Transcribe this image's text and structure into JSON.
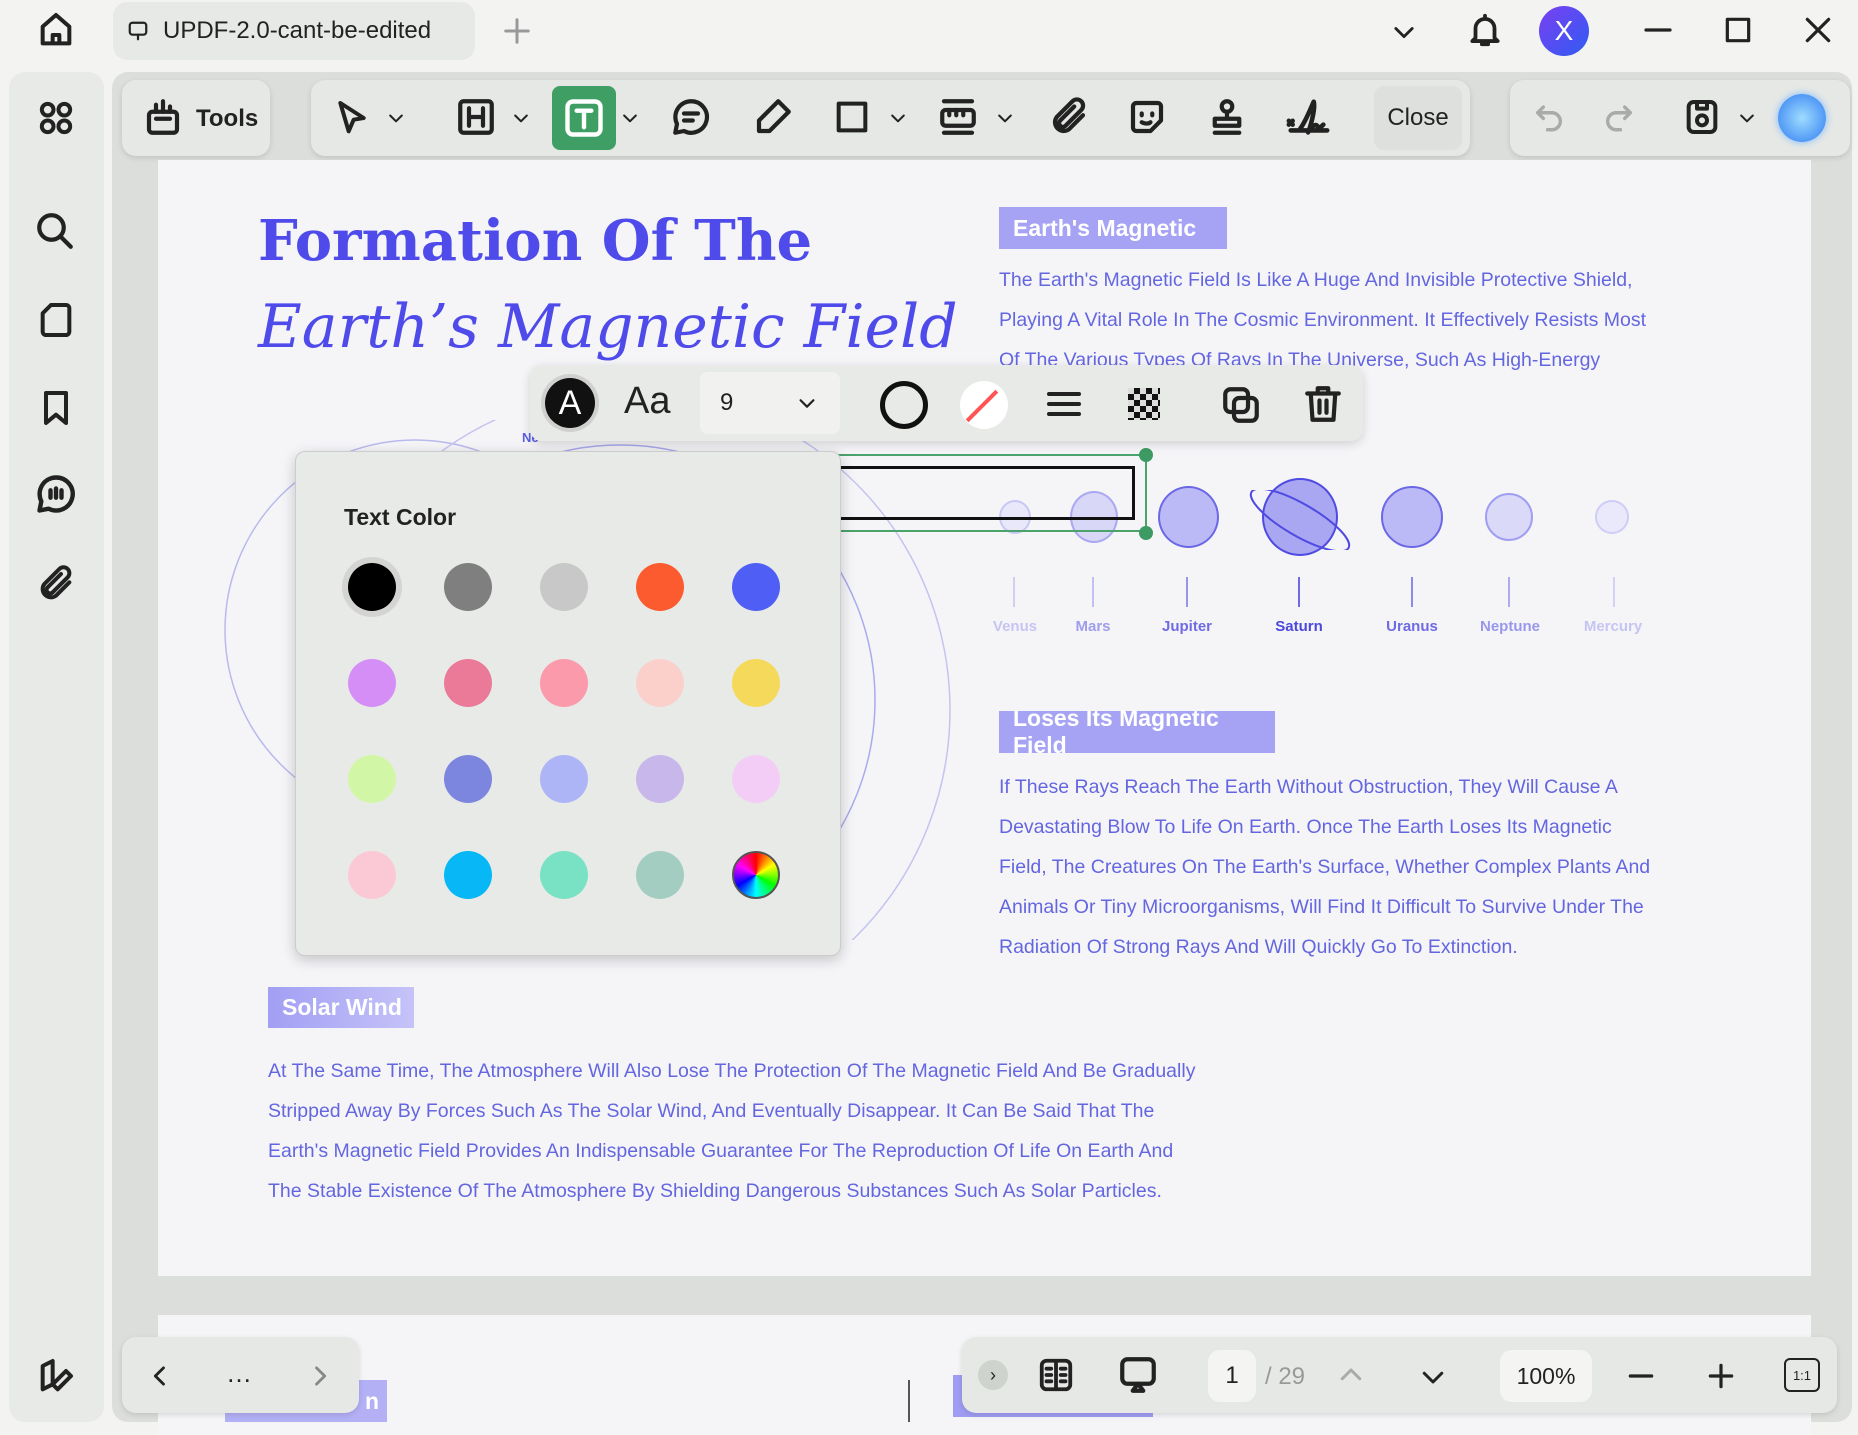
{
  "window": {
    "tab_title": "UPDF-2.0-cant-be-edited",
    "avatar_letter": "X"
  },
  "toolbar": {
    "tools_label": "Tools",
    "close_label": "Close"
  },
  "document": {
    "title_line1": "Formation Of The",
    "title_line2": "Earth’s Magnetic Field",
    "badge1": "Earth's Magnetic",
    "para1": [
      "The Earth's Magnetic Field Is Like A Huge And Invisible Protective Shield,",
      "Playing A Vital Role In The Cosmic Environment. It Effectively Resists Most",
      "Of The Various Types Of Rays In The Universe, Such As High-Energy"
    ],
    "planets": [
      "Venus",
      "Mars",
      "Jupiter",
      "Saturn",
      "Uranus",
      "Neptune",
      "Mercury"
    ],
    "partial_label": "Ne",
    "badge2": "Loses Its Magnetic Field",
    "para2": [
      "If These Rays Reach The Earth Without Obstruction, They Will Cause A",
      "Devastating Blow To Life On Earth. Once The Earth Loses Its Magnetic",
      "Field, The Creatures On The Earth's Surface, Whether Complex Plants And",
      "Animals Or Tiny Microorganisms, Will Find It Difficult To Survive Under The",
      "Radiation Of Strong Rays And Will Quickly Go To Extinction."
    ],
    "badge3": "Solar Wind",
    "para3": [
      "At The Same Time, The Atmosphere Will Also Lose The Protection Of The Magnetic Field And Be Gradually",
      "Stripped Away By Forces Such As The Solar Wind, And Eventually Disappear. It Can Be Said That The",
      "Earth's Magnetic Field Provides An Indispensable Guarantee For The Reproduction Of Life On Earth And",
      "The Stable Existence Of The Atmosphere By Shielding Dangerous Substances Such As Solar Particles."
    ],
    "next_badge_partial": "n"
  },
  "text_toolbar": {
    "font_glyph": "A",
    "font_style_label": "Aa",
    "font_size": "9"
  },
  "color_popup": {
    "title": "Text Color",
    "selected": "#000000",
    "colors": [
      "#000000",
      "#7f7f7f",
      "#c8c8c8",
      "#fb5b2e",
      "#4f5ff5",
      "#d48ef5",
      "#ea7a97",
      "#fa9aaa",
      "#fbd0cb",
      "#f4d95b",
      "#d1f7a6",
      "#7c86de",
      "#aeb5f7",
      "#c8b7ea",
      "#f3cdf5",
      "#fbc9d5",
      "#07b7f6",
      "#79e2c4",
      "#a4cdc2",
      "conic"
    ]
  },
  "bottom": {
    "more": "…",
    "page_current": "1",
    "page_total": "/ 29",
    "zoom": "100%",
    "actual_size": "1:1"
  }
}
